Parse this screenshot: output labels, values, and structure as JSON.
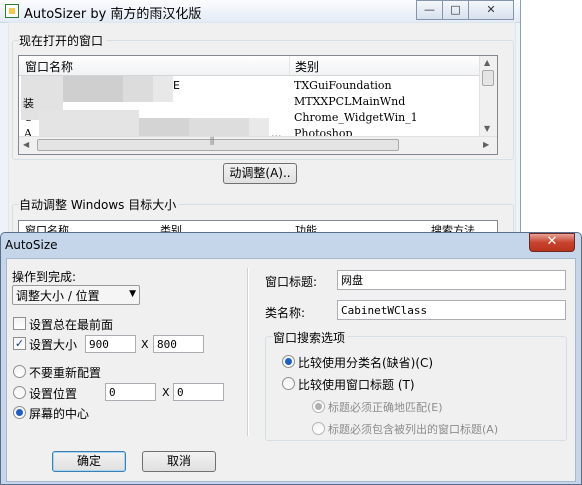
{
  "main_window": {
    "title": "AutoSizer by 南方的雨汉化版",
    "caption_buttons": {
      "minimize": "—",
      "maximize": "□",
      "close": "✕"
    },
    "open_windows_group": "现在打开的窗口",
    "list_headers": {
      "name": "窗口名称",
      "class": "类别"
    },
    "rows": [
      {
        "name": "",
        "class": "TXGuiFoundation"
      },
      {
        "name": "",
        "class": "MTXXPCLMainWnd"
      },
      {
        "name": "C",
        "class": "Chrome_WidgetWin_1"
      },
      {
        "name": "A",
        "class": "Photoshop"
      }
    ],
    "row_fragments": {
      "row0_tail": "E",
      "row1_head": "装",
      "row3_ellipsis": "..."
    },
    "hscroll_grip": "⫼",
    "adjust_button": "动调整(A)..",
    "auto_group": "自动调整 Windows 目标大小",
    "auto_headers": {
      "name": "窗口名称",
      "class": "类别",
      "function": "功能",
      "method": "搜索方法"
    }
  },
  "dialog": {
    "title": "AutoSize",
    "close": "✕",
    "action_label": "操作到完成:",
    "action_value": "调整大小 / 位置",
    "always_on_top": {
      "label": "设置总在最前面",
      "checked": false
    },
    "set_size": {
      "label": "设置大小",
      "checked": true,
      "width": "900",
      "x": "X",
      "height": "800"
    },
    "position_options": [
      {
        "label": "不要重新配置",
        "selected": false
      },
      {
        "label": "设置位置",
        "selected": false,
        "x_value": "0",
        "x": "X",
        "y_value": "0"
      },
      {
        "label": "屏幕的中心",
        "selected": true
      }
    ],
    "window_title_label": "窗口标题:",
    "window_title_value": "网盘",
    "class_name_label": "类名称:",
    "class_name_value": "CabinetWClass",
    "search_group": "窗口搜索选项",
    "search_options": [
      {
        "label": "比较使用分类名(缺省)(C)",
        "selected": true,
        "disabled": false
      },
      {
        "label": "比较使用窗口标题 (T)",
        "selected": false,
        "disabled": false
      },
      {
        "label": "标题必须正确地匹配(E)",
        "selected": true,
        "disabled": true
      },
      {
        "label": "标题必须包含被列出的窗口标题(A)",
        "selected": false,
        "disabled": true
      }
    ],
    "ok_button": "确定",
    "cancel_button": "取消"
  },
  "colors": {
    "close_red": "#c7432e",
    "title_bg": "#c6d6ea",
    "radio_accent": "#1d5fc7"
  }
}
